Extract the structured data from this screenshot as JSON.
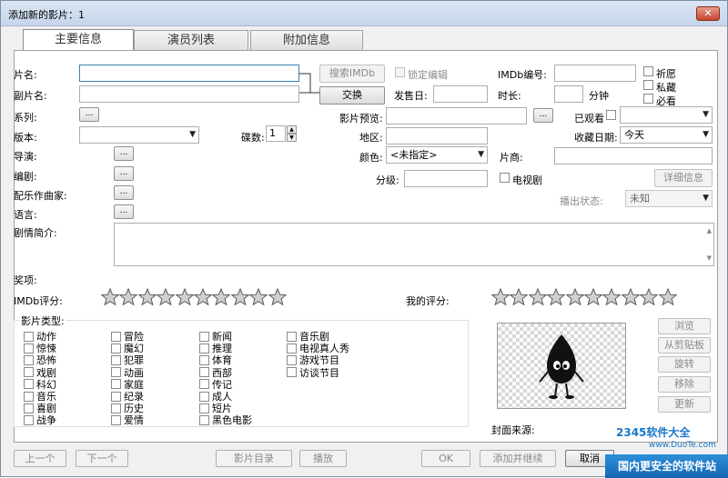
{
  "window": {
    "title": "添加新的影片：1",
    "close": "✕"
  },
  "tabs": [
    "主要信息",
    "演员列表",
    "附加信息"
  ],
  "labels": {
    "title": "片名:",
    "subtitle": "副片名:",
    "series": "系列:",
    "version": "版本:",
    "director": "导演:",
    "writer": "编剧:",
    "composer": "配乐作曲家:",
    "language": "语言:",
    "discs": "碟数:",
    "preview": "影片预览:",
    "region": "地区:",
    "color": "颜色:",
    "rating_level": "分级:",
    "release": "发售日:",
    "runtime": "时长:",
    "minutes": "分钟",
    "imdb_id": "IMDb编号:",
    "watched": "已观看",
    "collect_date": "收藏日期:",
    "studio": "片商:",
    "tv_series": "电视剧",
    "air_status": "播出状态:",
    "plot": "剧情简介:",
    "awards": "奖项:",
    "imdb_rating": "IMDb评分:",
    "my_rating": "我的评分:",
    "genres": "影片类型:",
    "cover_source": "封面来源:",
    "lock_edit": "锁定编辑",
    "wish": "祈愿",
    "private": "私藏",
    "must_watch": "必看"
  },
  "buttons": {
    "search_imdb": "搜索IMDb",
    "swap": "交换",
    "detail": "详细信息",
    "ellipsis": "...",
    "browse": "浏览",
    "from_clipboard": "从剪贴板",
    "rotate": "旋转",
    "remove": "移除",
    "update": "更新"
  },
  "values": {
    "discs": "1",
    "color": "<未指定>",
    "collect_date": "今天",
    "air_status": "未知"
  },
  "genres": [
    [
      "动作",
      "惊悚",
      "恐怖",
      "戏剧",
      "科幻",
      "音乐",
      "喜剧",
      "战争"
    ],
    [
      "冒险",
      "魔幻",
      "犯罪",
      "动画",
      "家庭",
      "纪录",
      "历史",
      "爱情"
    ],
    [
      "新闻",
      "推理",
      "体育",
      "西部",
      "传记",
      "成人",
      "短片",
      "黑色电影"
    ],
    [
      "音乐剧",
      "电视真人秀",
      "游戏节目",
      "访谈节目"
    ]
  ],
  "ratings": {
    "imdb": 10,
    "mine": 10
  },
  "bottom": {
    "prev": "上一个",
    "next": "下一个",
    "catalog": "影片目录",
    "play": "播放",
    "ok": "OK",
    "add_continue": "添加并继续",
    "cancel": "取消"
  },
  "watermark": {
    "brand": "2345软件大全",
    "url": "www.DuoTe.com",
    "banner": "国内更安全的软件站"
  }
}
